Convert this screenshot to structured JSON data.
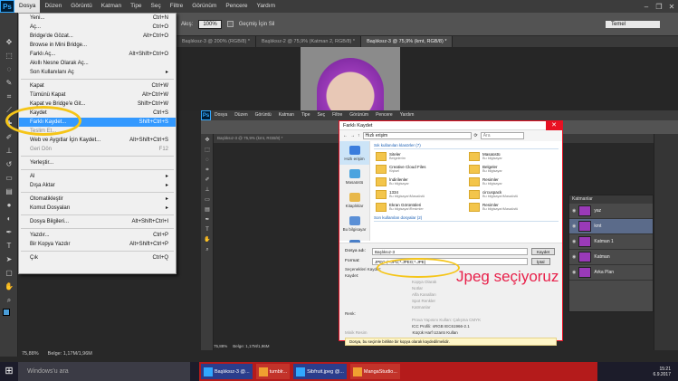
{
  "app": {
    "logo": "Ps"
  },
  "menubar": [
    "Dosya",
    "Düzen",
    "Görüntü",
    "Katman",
    "Tipe",
    "Seç",
    "Filtre",
    "Görünüm",
    "Pencere",
    "Yardım"
  ],
  "window_controls": [
    "–",
    "❐",
    "✕"
  ],
  "options": {
    "opacity_label": "Akış:",
    "opacity_value": "100%",
    "checkbox_label": "Geçmiş İçin Sil",
    "workspace": "Temel"
  },
  "tabs": [
    "Başlıksız-3 @ 200% (RGB/8) *",
    "Başlıksız-2 @ 75,9% (Katman 2, RGB/8) *",
    "Başlıksız-3 @ 75,9% (kmt, RGB/8) *"
  ],
  "file_menu": [
    {
      "label": "Yeni...",
      "shortcut": "Ctrl+N"
    },
    {
      "label": "Aç...",
      "shortcut": "Ctrl+O"
    },
    {
      "label": "Bridge'de Gözat...",
      "shortcut": "Alt+Ctrl+O"
    },
    {
      "label": "Browse in Mini Bridge...",
      "shortcut": ""
    },
    {
      "label": "Farklı Aç...",
      "shortcut": "Alt+Shift+Ctrl+O"
    },
    {
      "label": "Akıllı Nesne Olarak Aç...",
      "shortcut": ""
    },
    {
      "label": "Son Kullanılanı Aç",
      "shortcut": "▸"
    },
    {
      "sep": true
    },
    {
      "label": "Kapat",
      "shortcut": "Ctrl+W"
    },
    {
      "label": "Tümünü Kapat",
      "shortcut": "Alt+Ctrl+W"
    },
    {
      "label": "Kapat ve Bridge'e Git...",
      "shortcut": "Shift+Ctrl+W"
    },
    {
      "label": "Kaydet",
      "shortcut": "Ctrl+S"
    },
    {
      "label": "Farklı Kaydet...",
      "shortcut": "Shift+Ctrl+S",
      "highlight": true
    },
    {
      "label": "Teslim Et...",
      "shortcut": "",
      "disabled": true
    },
    {
      "label": "Web ve Aygıtlar İçin Kaydet...",
      "shortcut": "Alt+Shift+Ctrl+S"
    },
    {
      "label": "Geri Dön",
      "shortcut": "F12",
      "disabled": true
    },
    {
      "sep": true
    },
    {
      "label": "Yerleştir...",
      "shortcut": ""
    },
    {
      "sep": true
    },
    {
      "label": "Al",
      "shortcut": "▸"
    },
    {
      "label": "Dışa Aktar",
      "shortcut": "▸"
    },
    {
      "sep": true
    },
    {
      "label": "Otomatikleştir",
      "shortcut": "▸"
    },
    {
      "label": "Komut Dosyaları",
      "shortcut": "▸"
    },
    {
      "sep": true
    },
    {
      "label": "Dosya Bilgileri...",
      "shortcut": "Alt+Shift+Ctrl+I"
    },
    {
      "sep": true
    },
    {
      "label": "Yazdır...",
      "shortcut": "Ctrl+P"
    },
    {
      "label": "Bir Kopya Yazdır",
      "shortcut": "Alt+Shift+Ctrl+P"
    },
    {
      "sep": true
    },
    {
      "label": "Çık",
      "shortcut": "Ctrl+Q"
    }
  ],
  "status": {
    "zoom": "75,88%",
    "doc": "Belge: 1,17M/1,96M"
  },
  "ps2": {
    "menu": [
      "Dosya",
      "Düzen",
      "Görüntü",
      "Katman",
      "Tipe",
      "Seç",
      "Filtre",
      "Görünüm",
      "Pencere",
      "Yardım"
    ],
    "tab": "Başlıksız-3 @ 75,9% (kmt, RGB/8) *",
    "zoom": "75,88%",
    "doc": "Belge: 1,17M/1,96M"
  },
  "layers": {
    "title": "Katmanlar",
    "rows": [
      {
        "name": "yaz"
      },
      {
        "name": "kmt",
        "selected": true
      },
      {
        "name": "Katman 1"
      },
      {
        "name": "Katman"
      },
      {
        "name": "Arka Plan"
      }
    ]
  },
  "dialog": {
    "title": "Farklı Kaydet",
    "path": "Hızlı erişim",
    "search_placeholder": "Ara",
    "sidebar": [
      "Hızlı erişim",
      "Masaüstü",
      "Kitaplıklar",
      "Bu bilgisayar",
      "Ağ"
    ],
    "group1": "Sık kullanılan klasörler (7)",
    "folders": [
      {
        "name": "Siteler",
        "sub": "Belgelerim"
      },
      {
        "name": "Masaüstü",
        "sub": "Bu bilgisayar"
      },
      {
        "name": "Creative Cloud Files",
        "sub": "Kişisel"
      },
      {
        "name": "Belgeler",
        "sub": "Bu bilgisayar"
      },
      {
        "name": "İndirilenler",
        "sub": "Bu bilgisayar"
      },
      {
        "name": "Resimler",
        "sub": "Bu bilgisayar"
      },
      {
        "name": "1334",
        "sub": "Bu bilgisayar\\Masaüstü"
      },
      {
        "name": "circuspack",
        "sub": "Bu bilgisayar\\Masaüstü"
      },
      {
        "name": "Ekran Görüntüleri",
        "sub": "Bu bilgisayar\\Resimler"
      },
      {
        "name": "Resimler",
        "sub": "Bu bilgisayar\\Masaüstü"
      }
    ],
    "group2": "Son kullanılan dosyalar (2)",
    "filename_label": "Dosya adı:",
    "filename_value": "Başlıksız-3",
    "format_label": "Format:",
    "format_value": "JPEG (*.JPG;*.JPEG;*.JPE)",
    "save_btn": "Kaydet",
    "cancel_btn": "İptal",
    "save_options_label": "Seçenekleri Kaydet:",
    "save_label": "Kaydet:",
    "opt_copy": "Kopya Olarak",
    "opt_notes": "Notlar",
    "opt_alpha": "Alfa Kanalları",
    "opt_spot": "Spot Renkler",
    "opt_layers": "Katmanlar",
    "color_label": "Renk:",
    "opt_proof": "Prova Yapısını Kullan: Çalışma CMYK",
    "opt_icc": "ICC Profili: sRGB IEC61966-2.1",
    "opt_thumb": "Minik Resim",
    "opt_lower": "Küçük Harf Uzantı Kullan",
    "warning": "Dosya, bu seçimle birlikte bir kopya olarak kaydedilmelidir."
  },
  "annotation": "Jpeg seçiyoruz",
  "taskbar": {
    "search": "Windows'u ara",
    "items": [
      "Başlıksız-3 @...",
      "tumblr...",
      "Sibfruit.jpeg @...",
      "MangaStudio..."
    ],
    "time": "15:21",
    "date": "6.9.2017"
  },
  "colors": {
    "accent": "#3399ff",
    "ps_blue": "#31a8ff",
    "highlight_circle": "#f5c518",
    "annotation": "#e8204a",
    "taskbar_red": "#b41b1b"
  }
}
